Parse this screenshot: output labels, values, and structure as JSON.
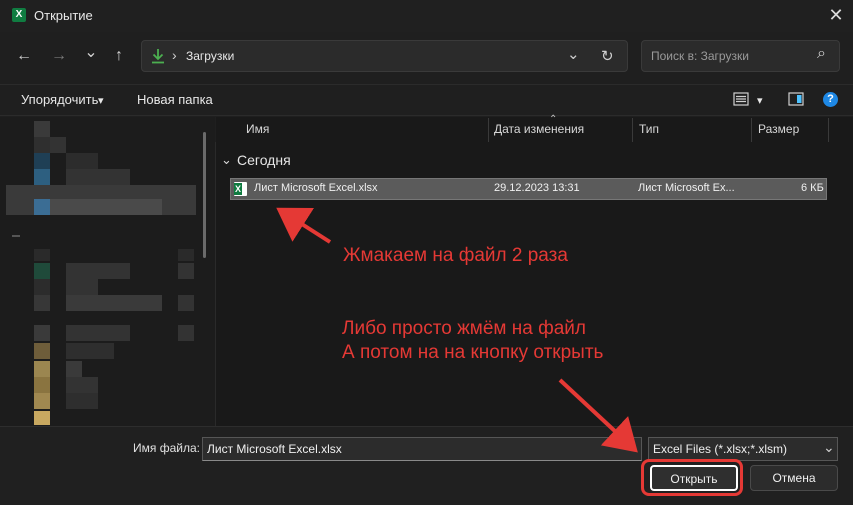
{
  "window": {
    "title": "Открытие",
    "app_icon": "excel-icon",
    "close_glyph": "✕"
  },
  "nav": {
    "back_glyph": "←",
    "forward_glyph": "→",
    "recent_glyph": "⌄",
    "up_glyph": "↑",
    "address_sep": "›",
    "address": "Загрузки",
    "dropdown_glyph": "⌄",
    "refresh_glyph": "↻",
    "search_placeholder": "Поиск в: Загрузки",
    "search_glyph": "⌕"
  },
  "toolbar": {
    "organize": "Упорядочить",
    "organize_caret": "▾",
    "new_folder": "Новая папка",
    "help": "?"
  },
  "columns": {
    "name": "Имя",
    "date": "Дата изменения",
    "type": "Тип",
    "size": "Размер",
    "sort_caret": "⌃"
  },
  "group": {
    "caret": "⌄",
    "label": "Сегодня"
  },
  "files": [
    {
      "name": "Лист Microsoft Excel.xlsx",
      "date": "29.12.2023 13:31",
      "type": "Лист Microsoft Ex...",
      "size": "6 КБ",
      "icon_letter": "X"
    }
  ],
  "bottom": {
    "filename_label": "Имя файла:",
    "filename_value": "Лист Microsoft Excel.xlsx",
    "filter": "Excel Files (*.xlsx;*.xlsm)",
    "filter_caret": "⌄",
    "open": "Открыть",
    "cancel": "Отмена"
  },
  "annotations": {
    "line1": "Жмакаем на файл 2 раза",
    "line2": "Либо просто жмём на файл",
    "line3": "А потом на на кнопку открыть"
  },
  "colors": {
    "annotation": "#e53935",
    "accent": "#4cc2ff",
    "excel": "#107c41"
  }
}
